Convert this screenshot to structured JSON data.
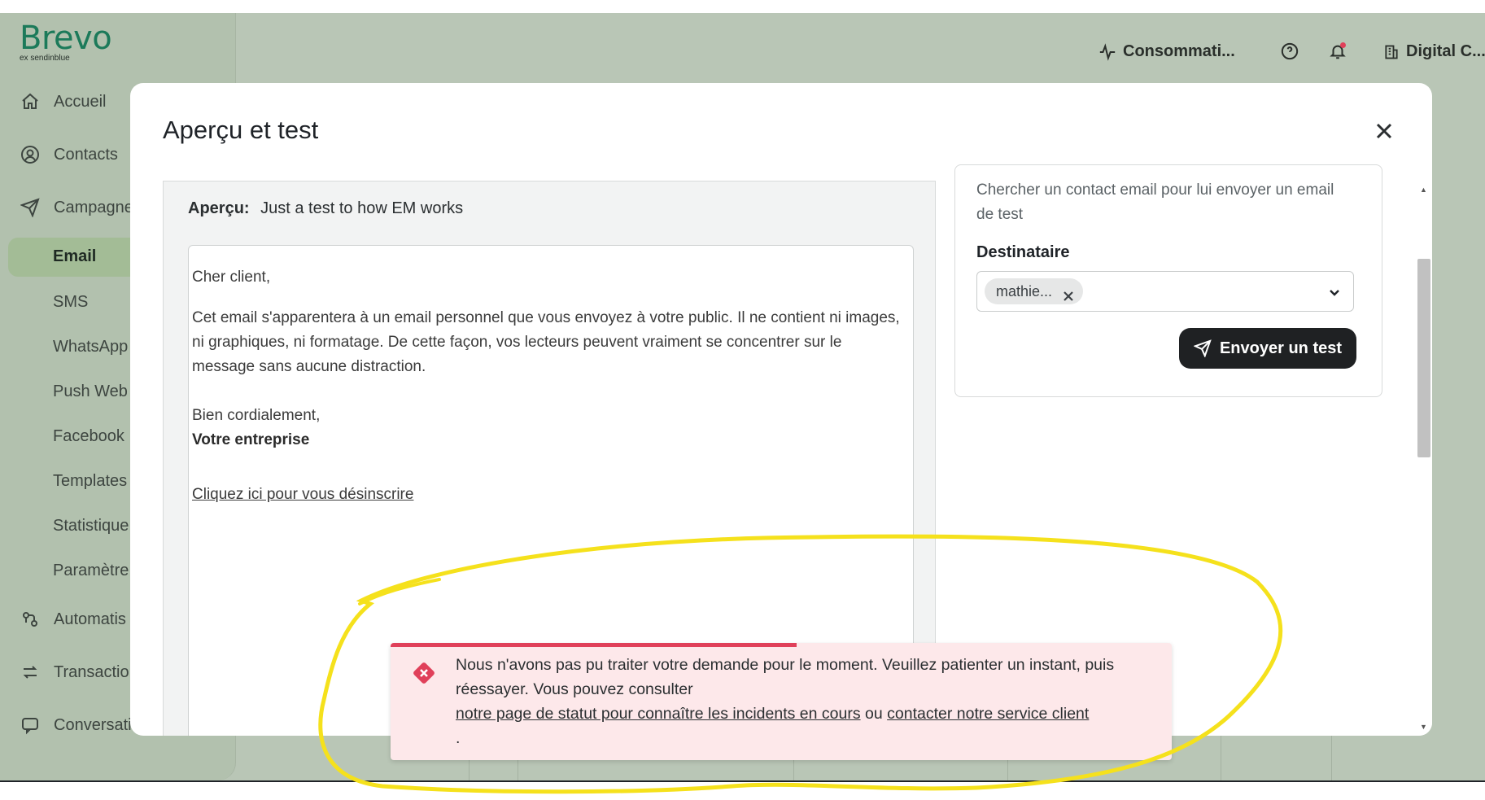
{
  "brand": {
    "name": "Brevo",
    "sub": "ex sendinblue",
    "color": "#1c7a5a"
  },
  "sidebar": {
    "items": [
      {
        "label": "Accueil",
        "icon": "home-icon"
      },
      {
        "label": "Contacts",
        "icon": "contacts-icon"
      },
      {
        "label": "Campagne",
        "icon": "send-icon"
      }
    ],
    "sub_items": [
      "Email",
      "SMS",
      "WhatsApp",
      "Push Web",
      "Facebook",
      "Templates",
      "Statistique",
      "Paramètre"
    ],
    "active_sub": "Email",
    "more_items": [
      {
        "label": "Automatis",
        "icon": "automation-icon"
      },
      {
        "label": "Transactio",
        "icon": "transfer-icon"
      },
      {
        "label": "Conversations",
        "icon": "chat-icon"
      }
    ]
  },
  "topbar": {
    "usage": "Consommati...",
    "account": "Digital C..."
  },
  "modal": {
    "title": "Aperçu et test",
    "preview_label": "Aperçu:",
    "preview_value": "Just a test to how EM works",
    "email": {
      "greeting": "Cher client,",
      "body": "Cet email s'apparentera à un email personnel que vous envoyez à votre public. Il ne contient ni images, ni graphiques, ni formatage. De cette façon, vos lecteurs peuvent vraiment se concentrer sur le message sans aucune distraction.",
      "closing": "Bien cordialement,",
      "signature": "Votre entreprise",
      "unsubscribe": "Cliquez ici pour vous désinscrire"
    },
    "test": {
      "description": "Chercher un contact email pour lui envoyer un email de test",
      "recipient_label": "Destinataire",
      "recipient_chip": "mathie...",
      "send_label": "Envoyer un test"
    }
  },
  "toast": {
    "message": "Nous n'avons pas pu traiter votre demande pour le moment. Veuillez patienter un instant, puis réessayer. Vous pouvez consulter",
    "link_status": "notre page de statut pour connaître les incidents en cours",
    "or": "ou",
    "link_support": "contacter notre service client",
    "end": ".",
    "progress": 0.52,
    "color": "#e0405a"
  },
  "annotation_color": "#f5e11c"
}
